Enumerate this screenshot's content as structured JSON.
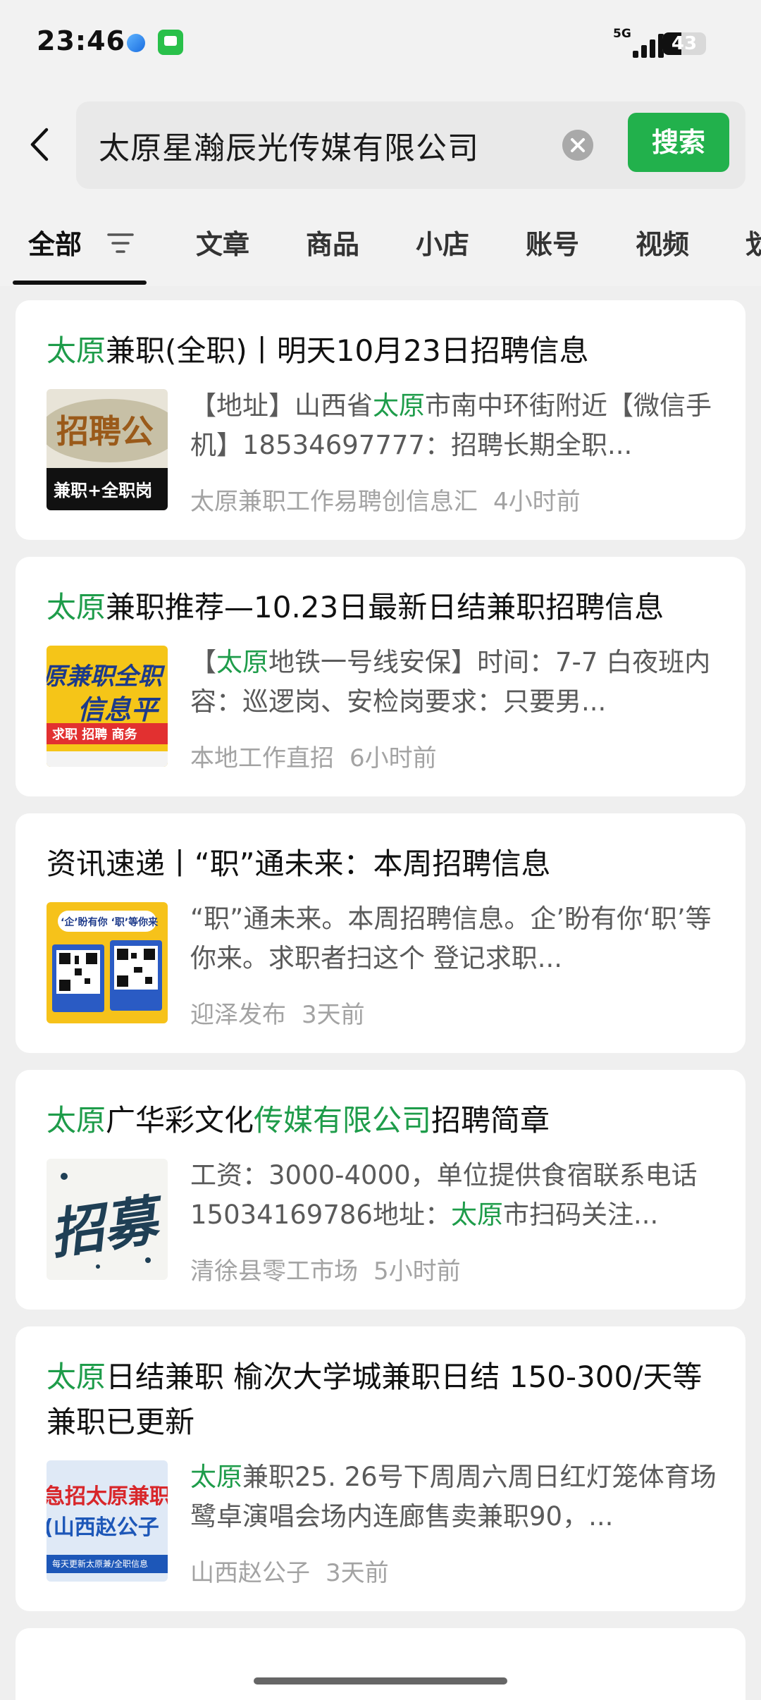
{
  "status_bar": {
    "time": "23:46",
    "network": "5G",
    "battery": "43",
    "battery_level": 0.43
  },
  "search": {
    "query": "太原星瀚辰光传媒有限公司",
    "button_label": "搜索"
  },
  "tabs": [
    "全部",
    "文章",
    "商品",
    "小店",
    "账号",
    "视频",
    "划"
  ],
  "results": [
    {
      "title": [
        [
          "太原",
          "hl"
        ],
        [
          "兼职(全职)丨明天10月23日招聘信息",
          ""
        ]
      ],
      "snippet": [
        [
          "【地址】山西省",
          ""
        ],
        [
          "太原",
          "hl"
        ],
        [
          "市南中环街附近【微信手机】18534697777：招聘长期全职...",
          ""
        ]
      ],
      "source": "太原兼职工作易聘创信息汇",
      "time": "4小时前",
      "thumb_text": [
        "招聘公",
        "兼职+全职岗"
      ],
      "thumb_icon": "recruit-poster-icon"
    },
    {
      "title": [
        [
          "太原",
          "hl"
        ],
        [
          "兼职推荐—10.23日最新日结兼职招聘信息",
          ""
        ]
      ],
      "snippet": [
        [
          "【",
          ""
        ],
        [
          "太原",
          "hl"
        ],
        [
          "地铁一号线安保】时间：7-7 白夜班内容：巡逻岗、安检岗要求：只要男...",
          ""
        ]
      ],
      "source": "本地工作直招",
      "time": "6小时前",
      "thumb_text": [
        "原兼职全职",
        "信息平",
        "求职 招聘 商务"
      ],
      "thumb_icon": "job-platform-banner-icon"
    },
    {
      "title": [
        [
          "资讯速递丨“职”通未来：本周招聘信息",
          ""
        ]
      ],
      "snippet": [
        [
          "“职”通未来。本周招聘信息。企’盼有你‘职’等你来。求职者扫这个 登记求职...",
          ""
        ]
      ],
      "source": "迎泽发布",
      "time": "3天前",
      "thumb_text": [
        "‘企’盼有你 ‘职’等你来"
      ],
      "thumb_icon": "qr-code-icon"
    },
    {
      "title": [
        [
          "太原",
          "hl"
        ],
        [
          "广华彩文化",
          ""
        ],
        [
          "传媒有限公司",
          "hl"
        ],
        [
          "招聘简章",
          ""
        ]
      ],
      "snippet": [
        [
          "工资：3000-4000，单位提供食宿联系电话15034169786地址：",
          ""
        ],
        [
          "太原",
          "hl"
        ],
        [
          "市扫码关注...",
          ""
        ]
      ],
      "source": "清徐县零工市场",
      "time": "5小时前",
      "thumb_text": [
        "招募"
      ],
      "thumb_icon": "calligraphy-recruit-icon"
    },
    {
      "title": [
        [
          "太原",
          "hl"
        ],
        [
          "日结兼职 榆次大学城兼职日结 150-300/天等兼职已更新",
          ""
        ]
      ],
      "snippet": [
        [
          "太原",
          "hl"
        ],
        [
          "兼职25. 26号下周周六周日红灯笼体育场鹭卓演唱会场内连廊售卖兼职90，...",
          ""
        ]
      ],
      "source": "山西赵公子",
      "time": "3天前",
      "thumb_text": [
        "急招太原兼职",
        "(山西赵公子",
        "每天更新太原兼/全职信息"
      ],
      "thumb_icon": "urgent-hiring-banner-icon"
    }
  ]
}
